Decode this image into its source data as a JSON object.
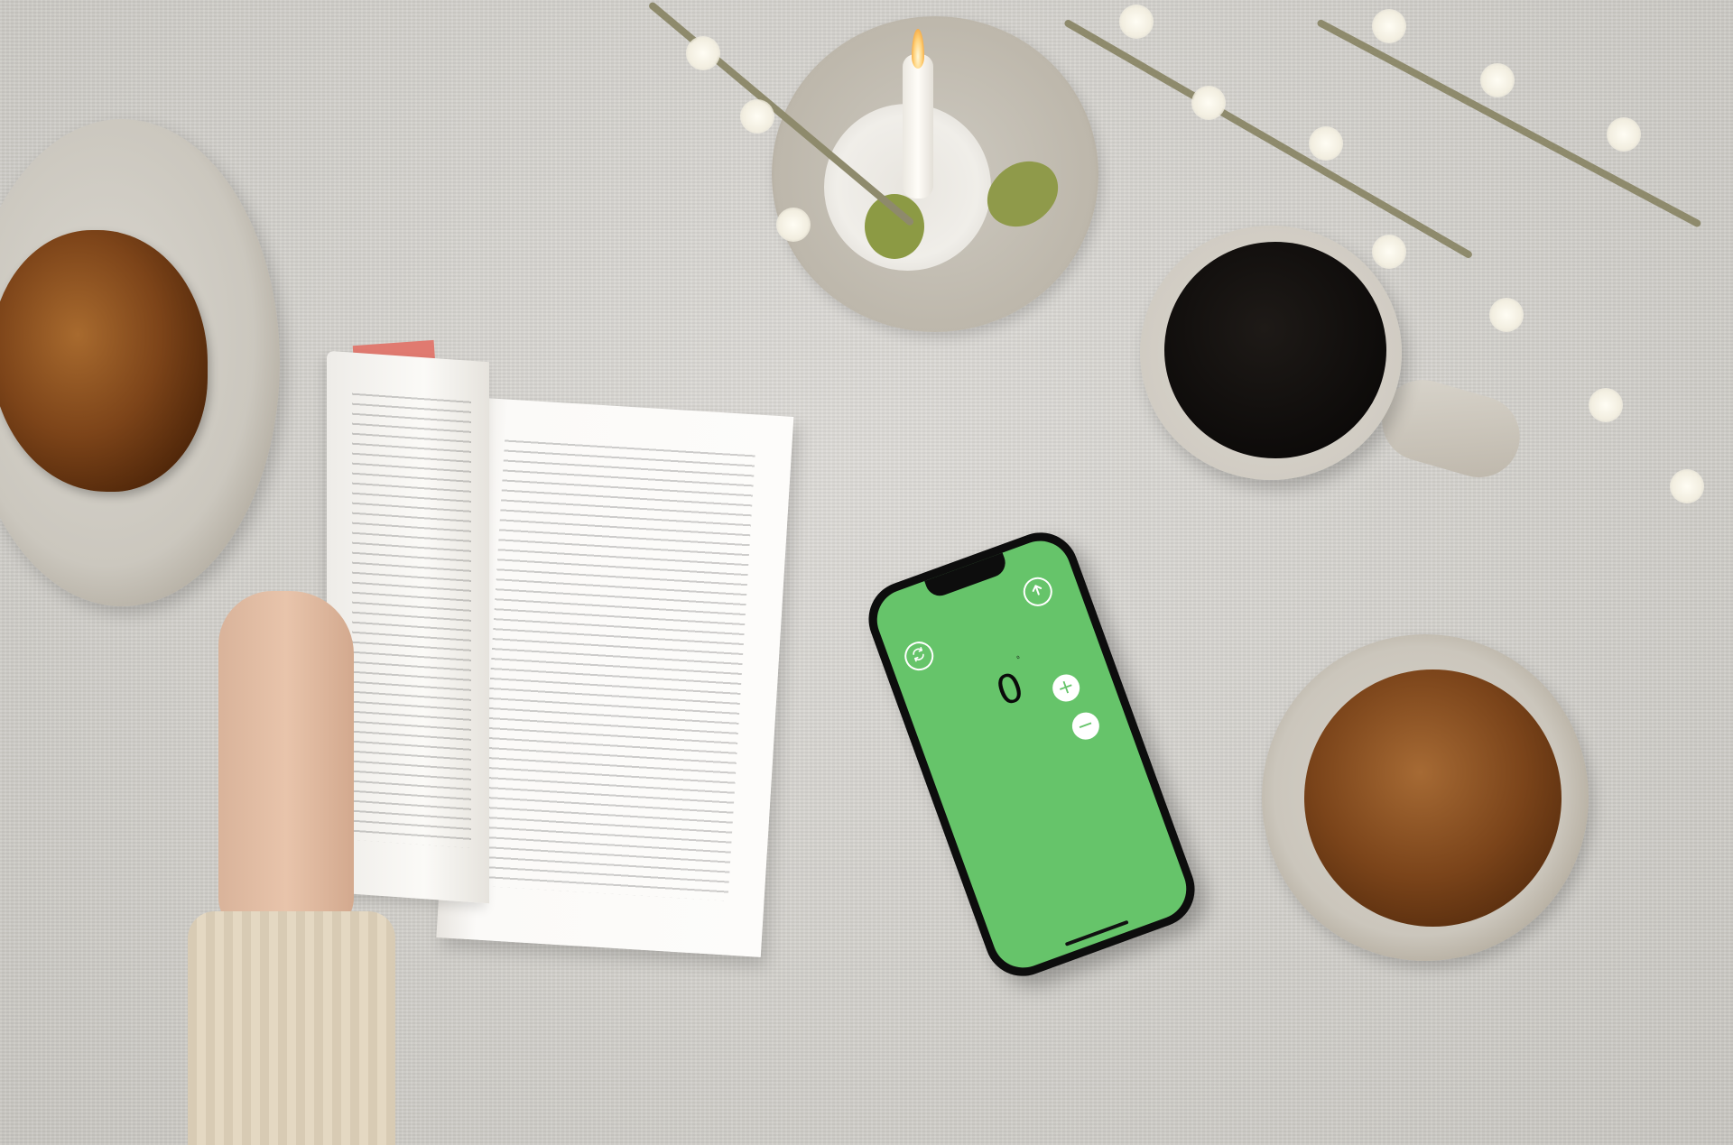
{
  "counter_app": {
    "value": "0",
    "unit_label": "⁰",
    "background_color": "#66c46a",
    "buttons": {
      "share_icon": "share-up-arrow-icon",
      "reset_icon": "reset-arrows-icon",
      "increment_label": "+",
      "decrement_label": "−"
    }
  }
}
